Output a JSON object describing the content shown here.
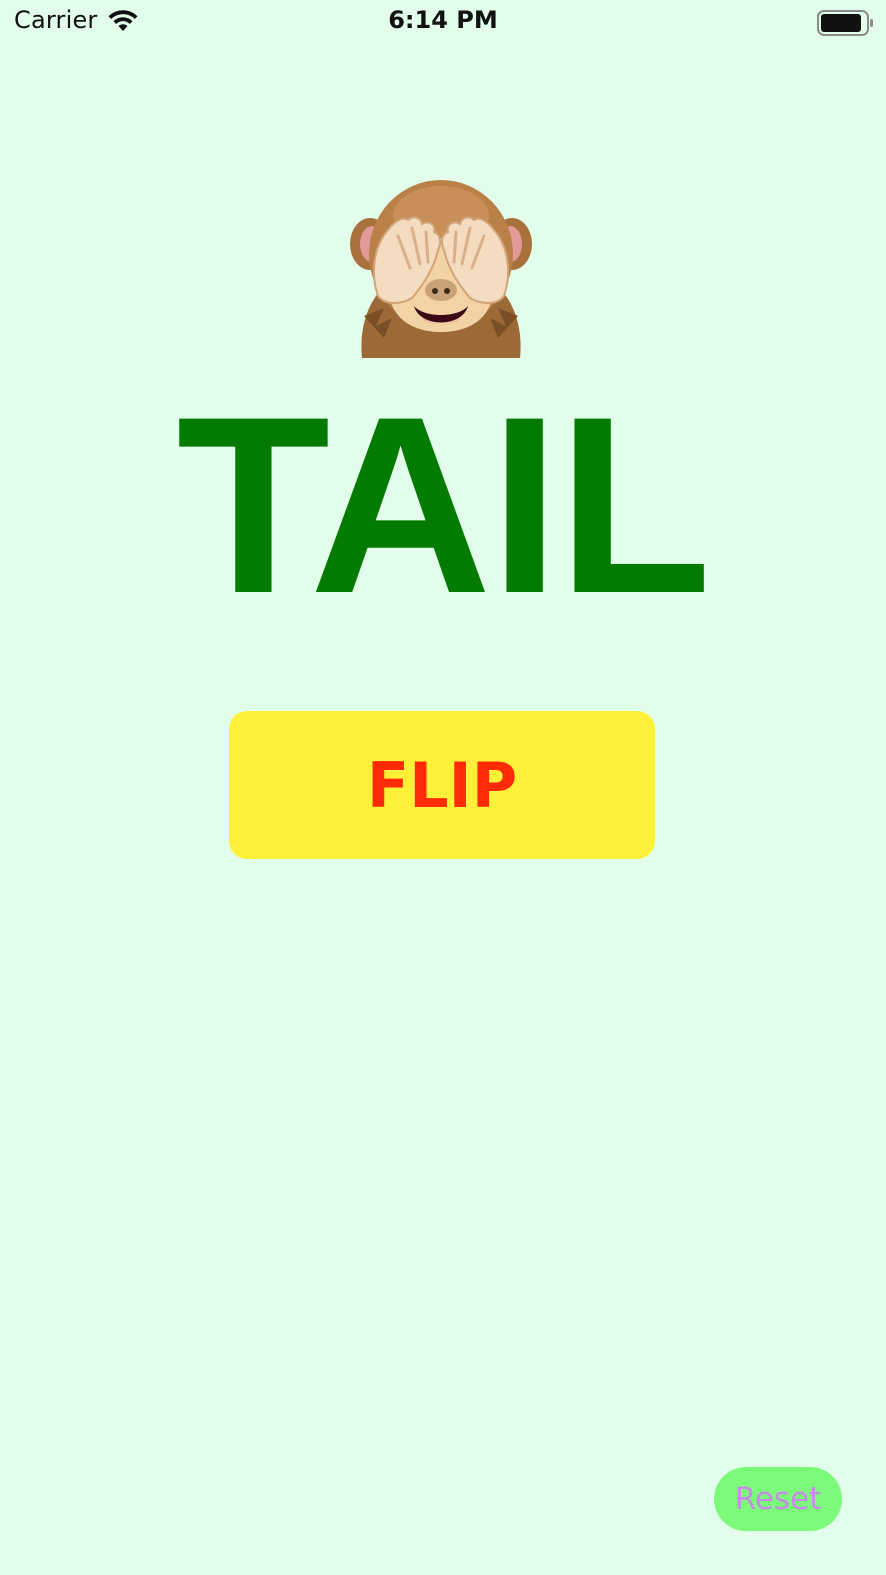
{
  "status_bar": {
    "carrier": "Carrier",
    "time": "6:14 PM",
    "wifi_icon": "wifi-icon",
    "battery_icon": "battery-icon"
  },
  "main": {
    "emoji_icon": "see-no-evil-monkey-icon",
    "result": "TAIL",
    "flip_label": "FLIP",
    "reset_label": "Reset"
  },
  "colors": {
    "background": "#e2fde9",
    "result_text": "#027b00",
    "flip_button_bg": "#fff03a",
    "flip_button_text": "#ff2a06",
    "reset_button_bg": "#7cfb7b",
    "reset_button_text": "#c88be8"
  }
}
